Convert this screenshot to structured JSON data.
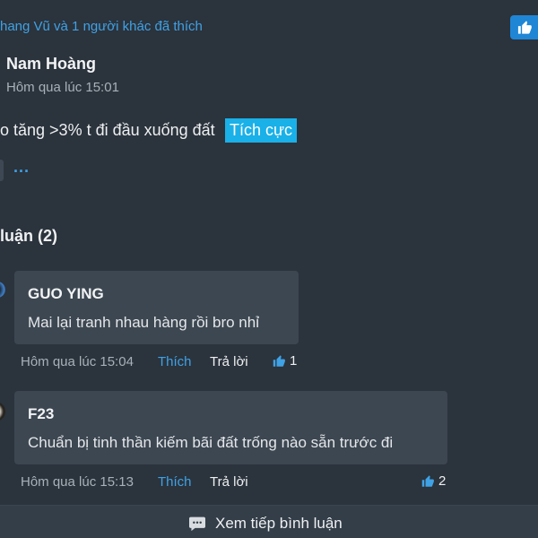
{
  "post": {
    "likes_text": "hang Vũ và 1 người khác đã thích",
    "author": "Nam Hoàng",
    "time": "Hôm qua lúc 15:01",
    "body": "o tăng >3% t đi đầu xuống đất",
    "sentiment": "Tích cực",
    "more_label": "...",
    "like_button_icon": "thumbs-up-icon"
  },
  "comments": {
    "heading": "luận (2)",
    "items": [
      {
        "author": "GUO YING",
        "text": "Mai lại tranh nhau hàng rồi bro nhỉ",
        "time": "Hôm qua lúc 15:04",
        "like_label": "Thích",
        "reply_label": "Trả lời",
        "like_count": "1"
      },
      {
        "author": "F23",
        "text": "Chuẩn bị tinh thần kiếm bãi đất trống nào sẵn trước đi",
        "time": "Hôm qua lúc 15:13",
        "like_label": "Thích",
        "reply_label": "Trả lời",
        "like_count": "2"
      }
    ],
    "more_label": "Xem tiếp bình luận"
  },
  "colors": {
    "background": "#2b333c",
    "bubble": "#3d4751",
    "link": "#3fa2e6",
    "sentiment_tag": "#1ab0e8",
    "like_button": "#1f86d6"
  }
}
